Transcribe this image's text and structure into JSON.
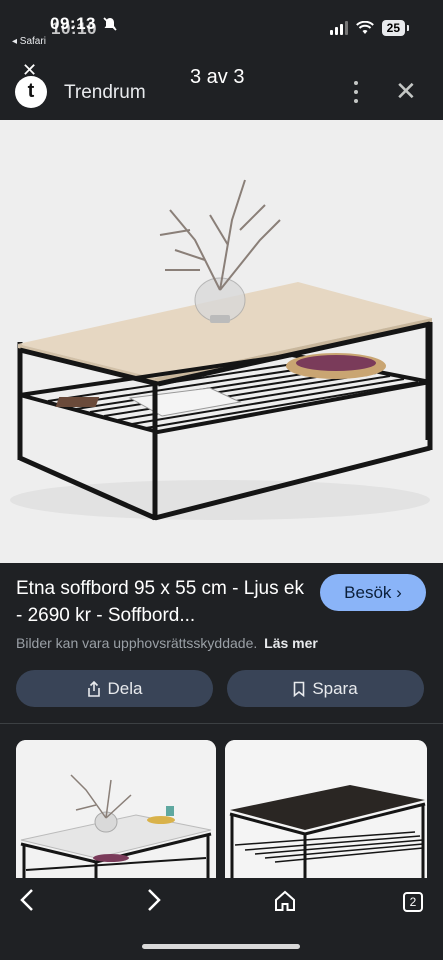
{
  "status_bar": {
    "time": "09:13",
    "time_overlay": "10:10",
    "back_app": "◂ Safari",
    "battery": "25"
  },
  "header": {
    "logo_letter": "t",
    "site_name": "Trendrum",
    "counter": "3 av 3"
  },
  "main_image": {
    "alt": "Etna soffbord coffee table with light oak top and black metal frame"
  },
  "result": {
    "title": "Etna soffbord 95 x 55 cm - Ljus ek - 2690 kr - Soffbord...",
    "visit_label": "Besök ›",
    "copyright_text": "Bilder kan vara upphovsrättsskyddade.",
    "read_more": "Läs mer",
    "share_label": "Dela",
    "save_label": "Spara"
  },
  "bottom_nav": {
    "tabs_count": "2"
  },
  "colors": {
    "background": "#1f2124",
    "accent": "#8ab4f8",
    "button_bg": "#394457"
  }
}
